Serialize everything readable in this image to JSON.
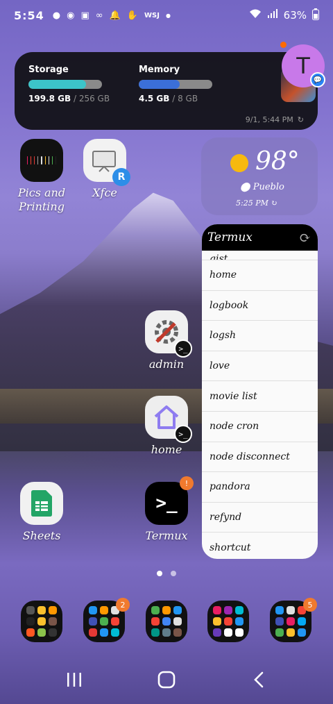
{
  "status_bar": {
    "time": "5:54",
    "notif_icons": [
      "chat-bubble-icon",
      "gamepad-icon",
      "cast-icon",
      "voicemail-icon",
      "bell-icon",
      "hand-icon"
    ],
    "wsj": "WSJ",
    "battery": "63%"
  },
  "system_widget": {
    "storage_label": "Storage",
    "storage_used": "199.8 GB",
    "storage_total": " / 256 GB",
    "storage_fraction": 0.78,
    "memory_label": "Memory",
    "memory_used": "4.5 GB",
    "memory_total": " / 8 GB",
    "memory_fraction": 0.56,
    "updated": "9/1, 5:44 PM",
    "storage_color": "#3cc4c9",
    "memory_color": "#3b6fd8"
  },
  "avatar": {
    "letter": "T",
    "color": "#c879e9"
  },
  "apps": {
    "pics": "Pics and Printing",
    "xfce": "Xfce",
    "admin": "admin",
    "home": "home",
    "sheets": "Sheets",
    "termux": "Termux",
    "termux_badge": "!"
  },
  "weather": {
    "temp": "98°",
    "location": "Pueblo",
    "time": "5:25 PM"
  },
  "termux_widget": {
    "title": "Termux",
    "items": [
      "gist",
      "home",
      "logbook",
      "logsh",
      "love",
      "movie list",
      "node cron",
      "node disconnect",
      "pandora",
      "refynd",
      "shortcut"
    ]
  },
  "dock": {
    "badge_2": "2",
    "badge_5": "5"
  }
}
